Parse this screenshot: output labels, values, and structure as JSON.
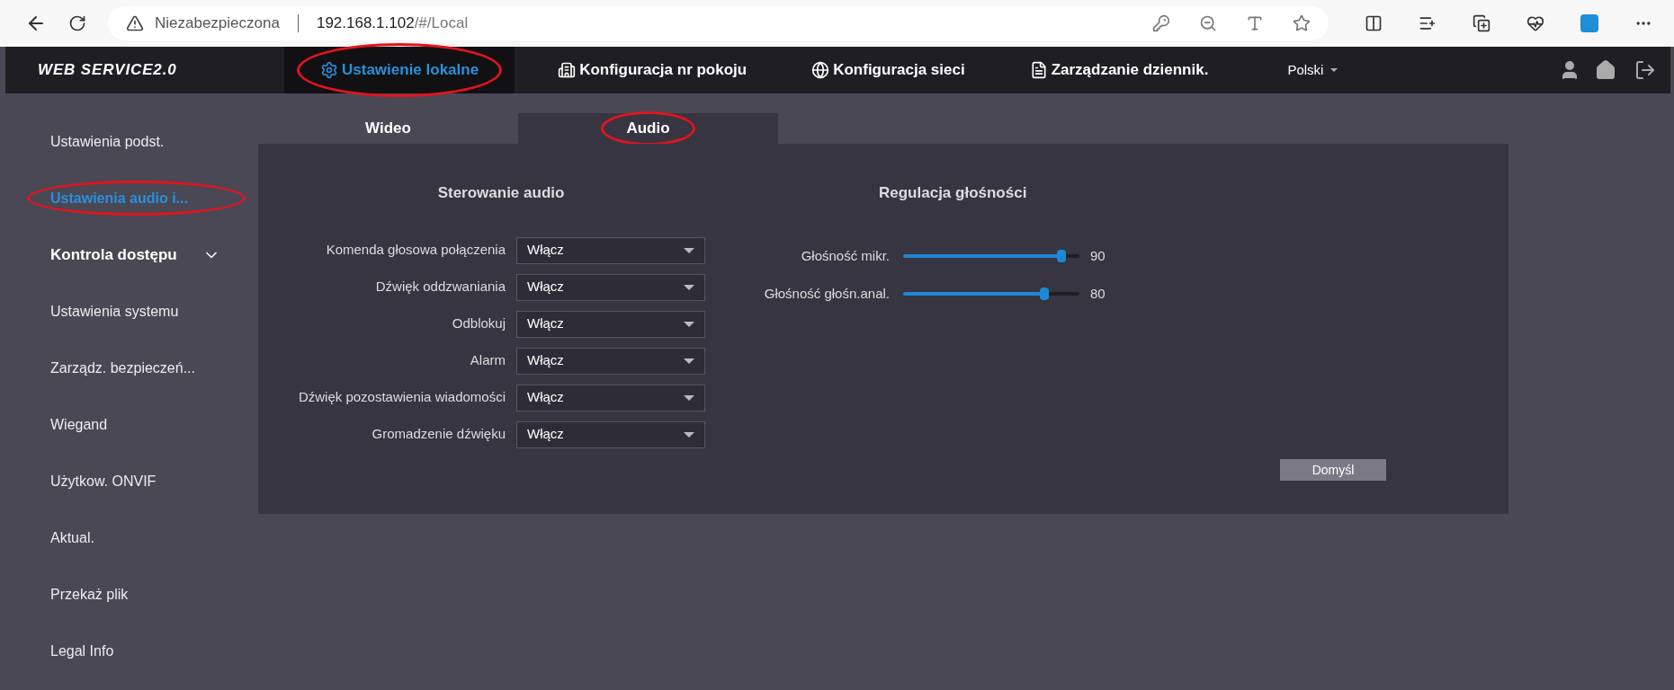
{
  "browser": {
    "security_label": "Niezabezpieczona",
    "url_host": "192.168.1.102",
    "url_path": "/#/Local"
  },
  "header": {
    "logo": "WEB SERVICE2.0",
    "nav": [
      {
        "kind": "gear",
        "label": "Ustawienie lokalne",
        "selected": true,
        "circled": true
      },
      {
        "kind": "building",
        "label": "Konfiguracja nr pokoju",
        "selected": false,
        "circled": false
      },
      {
        "kind": "globe",
        "label": "Konfiguracja sieci",
        "selected": false,
        "circled": false
      },
      {
        "kind": "log",
        "label": "Zarządzanie dziennik.",
        "selected": false,
        "circled": false
      }
    ],
    "language": "Polski"
  },
  "sidebar": {
    "items": [
      {
        "label": "Ustawienia podst.",
        "selected": false,
        "circled": false
      },
      {
        "label": "Ustawienia audio i...",
        "selected": true,
        "circled": true
      },
      {
        "label": "Kontrola dostępu",
        "selected": false,
        "circled": false,
        "expandable": true
      },
      {
        "label": "Ustawienia systemu",
        "selected": false,
        "circled": false
      },
      {
        "label": "Zarządz. bezpieczeń...",
        "selected": false,
        "circled": false
      },
      {
        "label": "Wiegand",
        "selected": false,
        "circled": false
      },
      {
        "label": "Użytkow. ONVIF",
        "selected": false,
        "circled": false
      },
      {
        "label": "Aktual.",
        "selected": false,
        "circled": false
      },
      {
        "label": "Przekaż plik",
        "selected": false,
        "circled": false
      },
      {
        "label": "Legal Info",
        "selected": false,
        "circled": false
      }
    ]
  },
  "tabs": [
    {
      "label": "Wideo",
      "selected": false,
      "circled": false
    },
    {
      "label": "Audio",
      "selected": true,
      "circled": true
    }
  ],
  "audio_control": {
    "title": "Sterowanie audio",
    "rows": [
      {
        "label": "Komenda głosowa połączenia",
        "value": "Włącz"
      },
      {
        "label": "Dźwięk oddzwaniania",
        "value": "Włącz"
      },
      {
        "label": "Odblokuj",
        "value": "Włącz"
      },
      {
        "label": "Alarm",
        "value": "Włącz"
      },
      {
        "label": "Dźwięk pozostawienia wiadomości",
        "value": "Włącz"
      },
      {
        "label": "Gromadzenie dźwięku",
        "value": "Włącz"
      }
    ]
  },
  "volume": {
    "title": "Regulacja głośności",
    "sliders": [
      {
        "label": "Głośność mikr.",
        "level": 0.9,
        "reading": "90"
      },
      {
        "label": "Głośność głośn.anal.",
        "level": 0.8,
        "reading": "80"
      }
    ]
  },
  "default_button": "Domyśl"
}
